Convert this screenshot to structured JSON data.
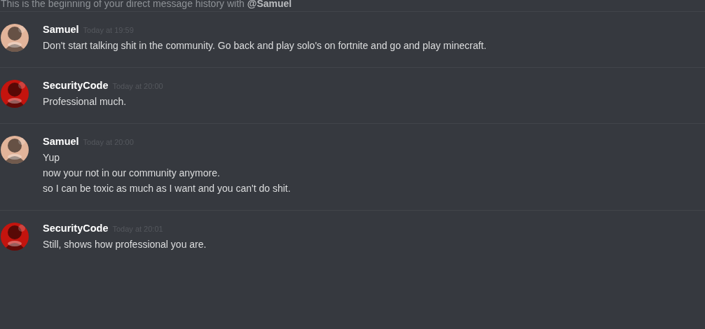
{
  "intro": "This is the beginning of your direct message history with **@Samuel**",
  "messages": [
    {
      "author": "Samuel",
      "color": "#e2b49a",
      "timestamp": "Today at 19:59",
      "lines": [
        "Don't start talking shit in the community. Go back and play solo's on fortnite and go and play minecraft."
      ]
    },
    {
      "author": "SecurityCode",
      "color": "#c4140e",
      "timestamp": "Today at 20:00",
      "lines": [
        "Professional much."
      ]
    },
    {
      "author": "Samuel",
      "color": "#e2b49a",
      "timestamp": "Today at 20:00",
      "lines": [
        "Yup",
        "now your not in our community anymore.",
        "so I can be toxic as much as I want and you can't do shit."
      ]
    },
    {
      "author": "SecurityCode",
      "color": "#c4140e",
      "timestamp": "Today at 20:01",
      "lines": [
        "Still, shows how professional you are."
      ]
    }
  ]
}
